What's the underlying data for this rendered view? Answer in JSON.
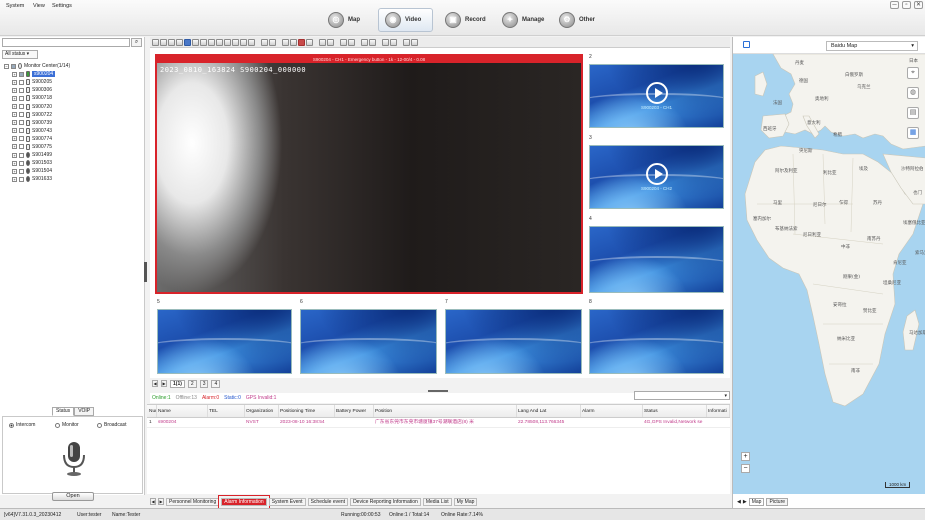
{
  "menubar": {
    "items": [
      "System",
      "View",
      "Settings"
    ]
  },
  "window_controls": [
    "─",
    "▫",
    "✕"
  ],
  "nav": [
    {
      "label": "Map",
      "icon": "map-icon",
      "active": false
    },
    {
      "label": "Video",
      "icon": "video-icon",
      "active": true
    },
    {
      "label": "Record",
      "icon": "record-icon",
      "active": false
    },
    {
      "label": "Manage",
      "icon": "manage-icon",
      "active": false
    },
    {
      "label": "Other",
      "icon": "other-icon",
      "active": false
    }
  ],
  "left": {
    "search_placeholder": "",
    "status_filter": "All status",
    "tree_root": "Monitor Center(1/14)",
    "devices": [
      "s900204",
      "S900205",
      "S900306",
      "S900718",
      "S900720",
      "S900722",
      "S900739",
      "S900743",
      "S900774",
      "S900775",
      "S901499",
      "S901503",
      "S901504",
      "S901633"
    ],
    "tabs": [
      "Status",
      "VOIP"
    ],
    "intercom_modes": [
      "Intercom",
      "Monitor",
      "Broadcast"
    ],
    "open_label": "Open"
  },
  "video": {
    "main_title": "S900204 - CH1 - Emergency button - 1k - 12-00/4 - 0.08",
    "osd": "2023_0810_163824 S900204_000000",
    "cells": [
      {
        "num": "2",
        "caption": "S900203 - CH1",
        "play": true
      },
      {
        "num": "3",
        "caption": "S900204 - CH2",
        "play": true
      },
      {
        "num": "4",
        "caption": "",
        "play": false
      },
      {
        "num": "5",
        "caption": "",
        "play": false
      },
      {
        "num": "6",
        "caption": "",
        "play": false
      },
      {
        "num": "7",
        "caption": "",
        "play": false
      },
      {
        "num": "8",
        "caption": "",
        "play": false
      }
    ],
    "pages": [
      "1(1)",
      "2",
      "3",
      "4"
    ]
  },
  "monitor_status": {
    "online": "Online:1",
    "offline": "Offline:13",
    "alarm": "Alarm:0",
    "static": "Static:0",
    "gps_invalid": "GPS Invalid:1"
  },
  "table": {
    "columns": [
      "Num",
      "Name",
      "TEL",
      "Organization",
      "Positioning Time",
      "Battery Power",
      "Position",
      "Lang And Lat",
      "Alarm",
      "Status",
      "Informati"
    ],
    "rows": [
      [
        "1",
        "s900204",
        "",
        "NVST",
        "2023-08-10 16:38:54",
        "",
        "广东省东莞市东莞市塘厦镇37号潮联酒店(8) 米",
        "22.78508,113.766345",
        "",
        "4G,GPS Invalid,Network se",
        ""
      ]
    ]
  },
  "bottom_tabs": [
    {
      "label": "Personnel Monitoring",
      "active": false
    },
    {
      "label": "Alarm Information",
      "active": true
    },
    {
      "label": "System Event",
      "active": false
    },
    {
      "label": "Schedule event",
      "active": false
    },
    {
      "label": "Device Reporting Information",
      "active": false
    },
    {
      "label": "Media List",
      "active": false
    },
    {
      "label": "My Map",
      "active": false
    }
  ],
  "statusbar": {
    "version": "[v64]V7.31.0.3_20230412",
    "user": "User:tester",
    "name": "Name:Tester",
    "running": "Running:00:00:53",
    "online": "Online:1 / Total:14",
    "rate": "Online Rate:7.14%"
  },
  "map": {
    "provider": "Baidu Map",
    "scale": "1000 km",
    "tabs": [
      "Map",
      "Picture"
    ],
    "ocean_color": "#a8d4f0",
    "land_color": "#f4f3ee",
    "labels": [
      "日本",
      "丹麦",
      "德国",
      "白俄罗斯",
      "乌克兰",
      "法国",
      "奥地利",
      "意大利",
      "西班牙",
      "希腊",
      "突尼斯",
      "阿尔及利亚",
      "利比亚",
      "埃及",
      "马里",
      "尼日尔",
      "乍得",
      "苏丹",
      "塞内加尔",
      "尼日利亚",
      "刚果(金)",
      "坦桑尼亚",
      "安哥拉",
      "赞比亚",
      "纳米比亚",
      "南非",
      "马达加斯加",
      "索马里",
      "肯尼亚",
      "南苏丹",
      "中非",
      "布基纳法索",
      "埃塞俄比亚",
      "也门",
      "沙特阿拉伯"
    ]
  }
}
